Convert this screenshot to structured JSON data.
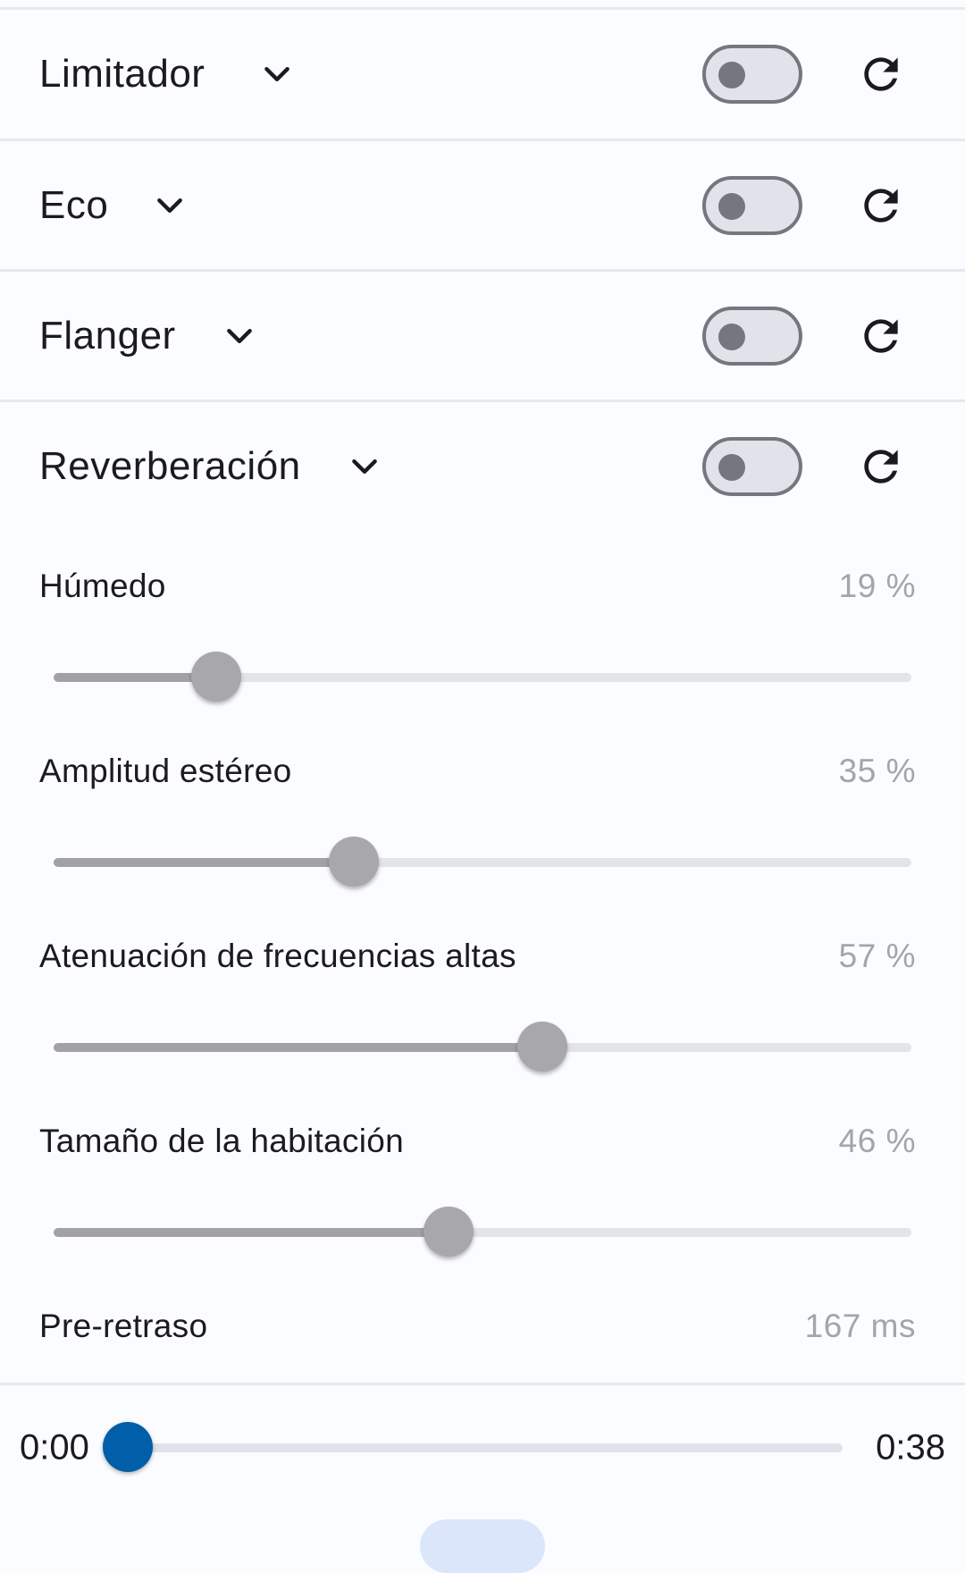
{
  "effects": [
    {
      "name": "Limitador",
      "enabled": false,
      "expanded": false
    },
    {
      "name": "Eco",
      "enabled": false,
      "expanded": false
    },
    {
      "name": "Flanger",
      "enabled": false,
      "expanded": false
    },
    {
      "name": "Reverberación",
      "enabled": false,
      "expanded": true
    }
  ],
  "reverb_params": [
    {
      "label": "Húmedo",
      "value_text": "19 %",
      "value": 0.19
    },
    {
      "label": "Amplitud estéreo",
      "value_text": "35 %",
      "value": 0.35
    },
    {
      "label": "Atenuación de frecuencias altas",
      "value_text": "57 %",
      "value": 0.57
    },
    {
      "label": "Tamaño de la habitación",
      "value_text": "46 %",
      "value": 0.46
    },
    {
      "label": "Pre-retraso",
      "value_text": "167 ms"
    }
  ],
  "player": {
    "current_time": "0:00",
    "total_time": "0:38",
    "progress": 0
  },
  "icons": {
    "expand": "chevron-down-icon",
    "reset": "refresh-icon"
  },
  "colors": {
    "accent": "#005fa8",
    "slider_inactive": "#a8a8ab",
    "secondary_text": "#a3a5ab"
  }
}
